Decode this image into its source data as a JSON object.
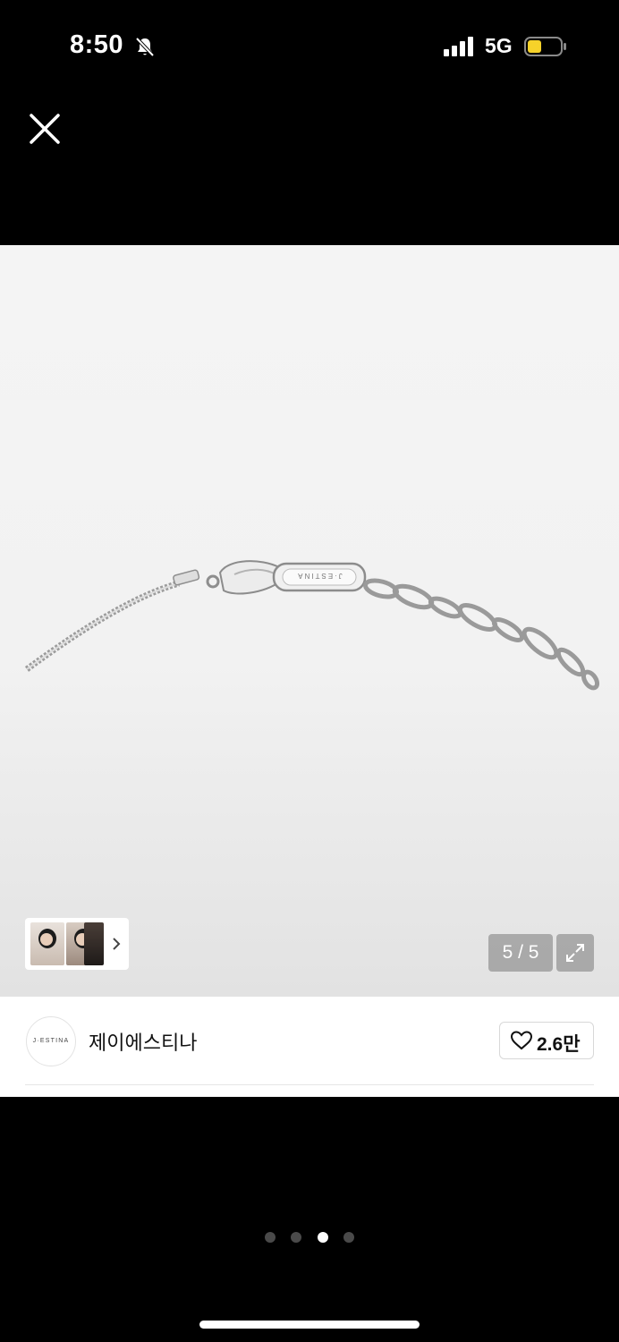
{
  "status_bar": {
    "time": "8:50",
    "network": "5G",
    "icons": [
      "bell-slash-icon",
      "signal-bars-icon",
      "battery-icon"
    ],
    "battery_color": "#f6d22a"
  },
  "header": {
    "close_icon": "close-icon"
  },
  "gallery": {
    "page_counter": "5 / 5",
    "expand_icon": "expand-icon",
    "thumbnail_icon": "chevron-right-icon",
    "engraving": "J·ESTINA"
  },
  "brand": {
    "logo_text": "J·ESTINA",
    "name": "제이에스티나",
    "like_count": "2.6만",
    "like_icon": "heart-icon"
  },
  "pager": {
    "total": 4,
    "active": 3
  },
  "colors": {
    "background": "#000000",
    "image_bg": "#f4f4f4",
    "text_dark": "#111111"
  }
}
